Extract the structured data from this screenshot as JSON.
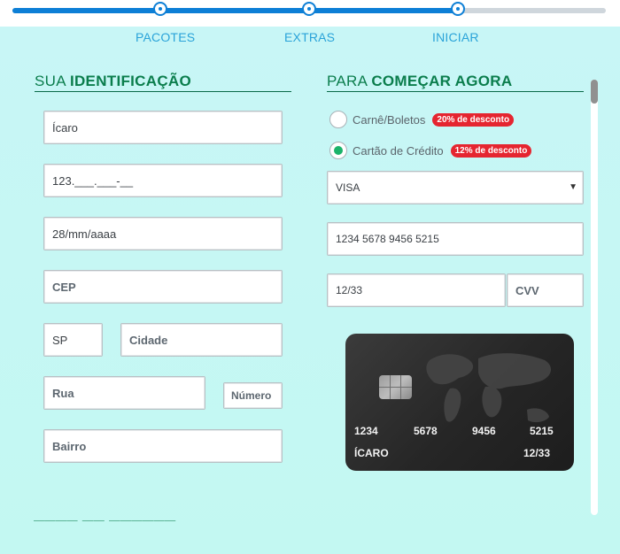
{
  "steps": [
    {
      "label": "PACOTES"
    },
    {
      "label": "EXTRAS"
    },
    {
      "label": "INICIAR"
    }
  ],
  "identification": {
    "title_light": "SUA",
    "title_bold": "IDENTIFICAÇÃO",
    "name_value": "Ícaro",
    "cpf_value": "123.___.___-__",
    "birth_value": "28/mm/aaaa",
    "cep_placeholder": "CEP",
    "state_value": "SP",
    "city_placeholder": "Cidade",
    "street_placeholder": "Rua",
    "number_placeholder": "Número",
    "district_placeholder": "Bairro"
  },
  "payment": {
    "title_light": "PARA",
    "title_bold": "COMEÇAR AGORA",
    "option_boleto": "Carnê/Boletos",
    "badge_boleto": "20% de desconto",
    "option_card": "Cartão de Crédito",
    "badge_card": "12% de desconto",
    "selected_option": "Cartão de Crédito",
    "card_brand": "VISA",
    "card_number": "1234 5678 9456 5215",
    "expiry": "12/33",
    "cvv_placeholder": "CVV"
  },
  "card_preview": {
    "groups": [
      "1234",
      "5678",
      "9456",
      "5215"
    ],
    "holder": "ÍCARO",
    "expiry": "12/33"
  },
  "colors": {
    "accent_blue": "#0d7fd6",
    "title_green": "#0a7d4c",
    "badge_red": "#e52530",
    "radio_green": "#1bb36a"
  }
}
